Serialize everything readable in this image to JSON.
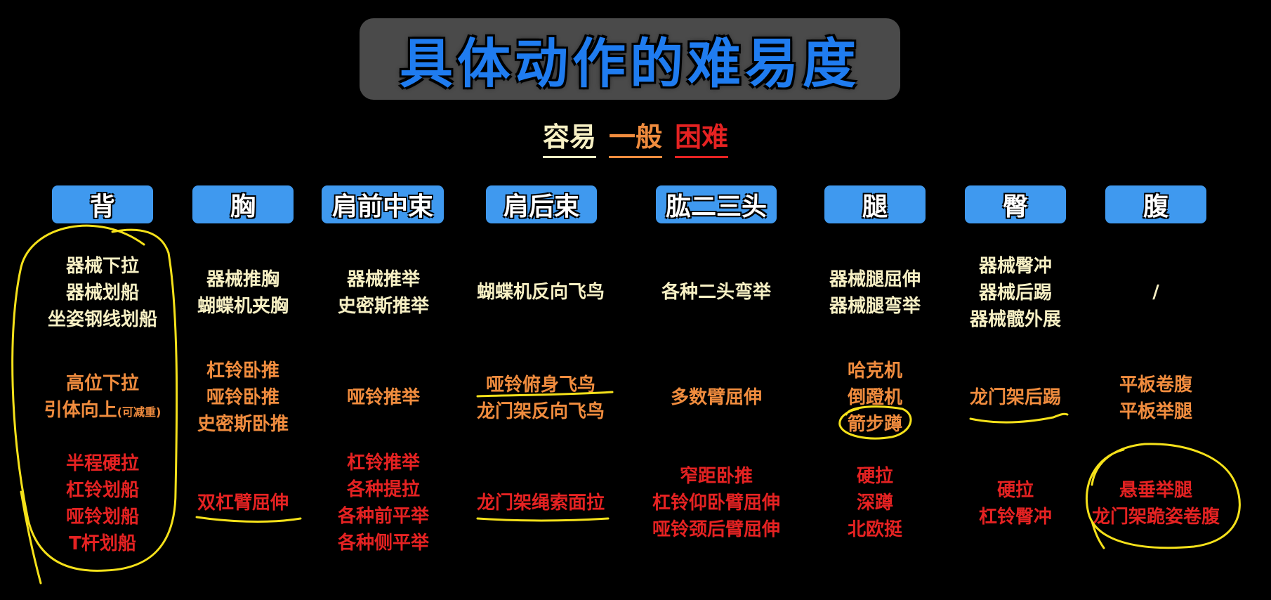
{
  "title": "具体动作的难易度",
  "legend": {
    "easy": "容易",
    "medium": "一般",
    "hard": "困难"
  },
  "colors": {
    "easy": "#f7f0c4",
    "medium": "#f08c3e",
    "hard": "#e52222",
    "header_bg": "#3f99ef",
    "title": "#1f7cf0",
    "annotation": "#f5e11a"
  },
  "columns": [
    {
      "header": "背",
      "easy": [
        "器械下拉",
        "器械划船",
        "坐姿钢线划船"
      ],
      "medium_lines": [
        "高位下拉",
        "引体向上"
      ],
      "medium_note": "(可减重)",
      "hard": [
        "半程硬拉",
        "杠铃划船",
        "哑铃划船",
        "T杆划船"
      ]
    },
    {
      "header": "胸",
      "easy": [
        "器械推胸",
        "蝴蝶机夹胸"
      ],
      "medium": [
        "杠铃卧推",
        "哑铃卧推",
        "史密斯卧推"
      ],
      "hard": [
        "双杠臂屈伸"
      ]
    },
    {
      "header": "肩前中束",
      "easy": [
        "器械推举",
        "史密斯推举"
      ],
      "medium": [
        "哑铃推举"
      ],
      "hard": [
        "杠铃推举",
        "各种提拉",
        "各种前平举",
        "各种侧平举"
      ]
    },
    {
      "header": "肩后束",
      "easy": [
        "蝴蝶机反向飞鸟"
      ],
      "medium": [
        "哑铃俯身飞鸟",
        "龙门架反向飞鸟"
      ],
      "hard": [
        "龙门架绳索面拉"
      ]
    },
    {
      "header": "肱二三头",
      "easy": [
        "各种二头弯举"
      ],
      "medium": [
        "多数臂屈伸"
      ],
      "hard": [
        "窄距卧推",
        "杠铃仰卧臂屈伸",
        "哑铃颈后臂屈伸"
      ]
    },
    {
      "header": "腿",
      "easy": [
        "器械腿屈伸",
        "器械腿弯举"
      ],
      "medium": [
        "哈克机",
        "倒蹬机",
        "箭步蹲"
      ],
      "hard": [
        "硬拉",
        "深蹲",
        "北欧挺"
      ]
    },
    {
      "header": "臀",
      "easy": [
        "器械臀冲",
        "器械后踢",
        "器械髋外展"
      ],
      "medium": [
        "龙门架后踢"
      ],
      "hard": [
        "硬拉",
        "杠铃臀冲"
      ]
    },
    {
      "header": "腹",
      "easy": [
        "/"
      ],
      "medium": [
        "平板卷腹",
        "平板举腿"
      ],
      "hard": [
        "悬垂举腿",
        "龙门架跪姿卷腹"
      ]
    }
  ]
}
